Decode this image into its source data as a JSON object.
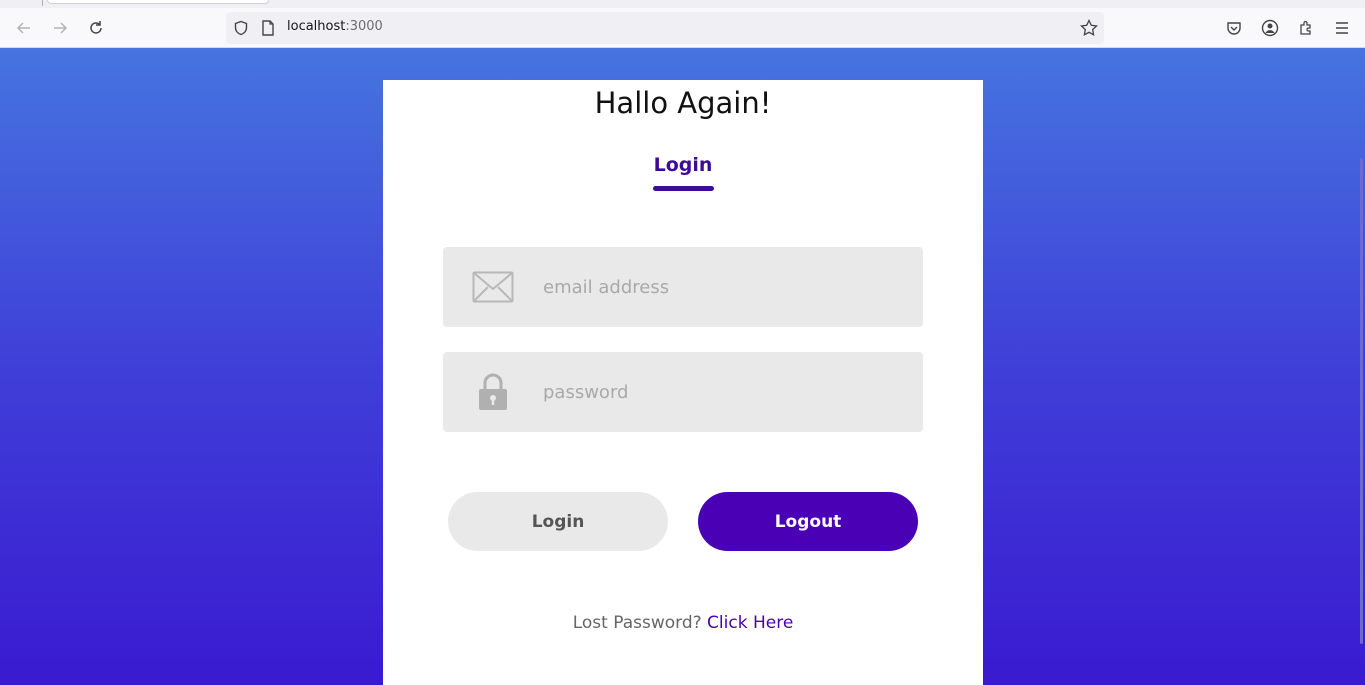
{
  "browser": {
    "url_host": "localhost",
    "url_port": ":3000"
  },
  "page": {
    "title": "Hallo Again!",
    "tab_label": "Login",
    "email_placeholder": "email address",
    "password_placeholder": "password",
    "login_button": "Login",
    "logout_button": "Logout",
    "lost_password_text": "Lost Password?",
    "click_here_link": "Click Here"
  },
  "colors": {
    "accent": "#4a00b5",
    "tab_color": "#3d0a9a",
    "field_bg": "#e9e9e9",
    "gradient_top": "#4674e0",
    "gradient_bottom": "#3a1ad0"
  }
}
